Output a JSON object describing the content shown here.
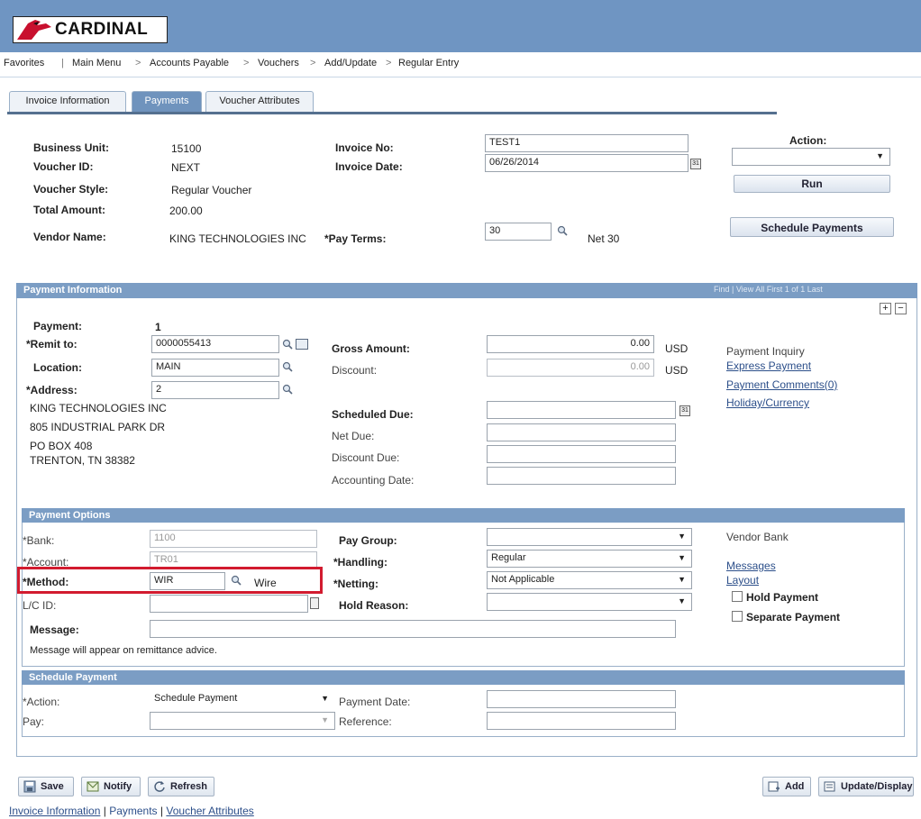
{
  "app": {
    "brand": "CARDINAL"
  },
  "breadcrumb": [
    "Favorites",
    "Main Menu",
    "Accounts Payable",
    "Vouchers",
    "Add/Update",
    "Regular Entry"
  ],
  "tabs": [
    {
      "label": "Invoice Information",
      "active": false
    },
    {
      "label": "Payments",
      "active": true
    },
    {
      "label": "Voucher Attributes",
      "active": false
    }
  ],
  "header": {
    "business_unit_label": "Business Unit:",
    "business_unit": "15100",
    "voucher_id_label": "Voucher ID:",
    "voucher_id": "NEXT",
    "voucher_style_label": "Voucher Style:",
    "voucher_style": "Regular Voucher",
    "total_amount_label": "Total Amount:",
    "total_amount": "200.00",
    "vendor_name_label": "Vendor Name:",
    "vendor_name": "KING TECHNOLOGIES INC",
    "invoice_no_label": "Invoice No:",
    "invoice_no": "TEST1",
    "invoice_date_label": "Invoice Date:",
    "invoice_date": "06/26/2014",
    "pay_terms_label": "*Pay Terms:",
    "pay_terms": "30",
    "pay_terms_desc": "Net 30",
    "action_label": "Action:",
    "action_value": "",
    "run_button": "Run",
    "schedule_payments_button": "Schedule Payments"
  },
  "payment_info": {
    "title": "Payment Information",
    "nav_text": "Find | View All  First  1 of 1  Last",
    "payment_label": "Payment:",
    "payment_value": "1",
    "remit_to_label": "*Remit to:",
    "remit_to": "0000055413",
    "location_label": "Location:",
    "location": "MAIN",
    "address_label": "*Address:",
    "address": "2",
    "address_lines": [
      "KING TECHNOLOGIES INC",
      "805 INDUSTRIAL PARK DR",
      "PO BOX 408",
      "TRENTON, TN  38382"
    ],
    "gross_amount_label": "Gross Amount:",
    "gross_amount": "0.00",
    "gross_currency": "USD",
    "discount_label": "Discount:",
    "discount": "0.00",
    "discount_currency": "USD",
    "scheduled_due_label": "Scheduled Due:",
    "scheduled_due": "",
    "net_due_label": "Net Due:",
    "net_due": "",
    "discount_due_label": "Discount Due:",
    "discount_due": "",
    "accounting_date_label": "Accounting Date:",
    "accounting_date": "",
    "payment_inquiry": "Payment Inquiry",
    "express_payment_link": "Express Payment",
    "payment_comments_link": "Payment Comments(0)",
    "holiday_currency_link": "Holiday/Currency"
  },
  "payment_options": {
    "title": "Payment Options",
    "bank_label": "*Bank:",
    "bank": "1100",
    "account_label": "*Account:",
    "account": "TR01",
    "method_label": "*Method:",
    "method": "WIR",
    "method_desc": "Wire",
    "lc_id_label": "L/C ID:",
    "lc_id": "",
    "message_label": "Message:",
    "message": "",
    "message_note": "Message will appear on remittance advice.",
    "pay_group_label": "Pay Group:",
    "pay_group": "",
    "handling_label": "*Handling:",
    "handling": "Regular",
    "netting_label": "*Netting:",
    "netting": "Not Applicable",
    "hold_reason_label": "Hold Reason:",
    "hold_reason": "",
    "vendor_bank": "Vendor Bank",
    "messages_link": "Messages",
    "layout_link": "Layout",
    "hold_payment_label": "Hold Payment",
    "separate_payment_label": "Separate Payment"
  },
  "schedule_payment": {
    "title": "Schedule Payment",
    "action_label": "*Action:",
    "action": "Schedule Payment",
    "pay_label": "Pay:",
    "pay": "",
    "payment_date_label": "Payment Date:",
    "payment_date": "",
    "reference_label": "Reference:",
    "reference": ""
  },
  "toolbar": {
    "save": "Save",
    "notify": "Notify",
    "refresh": "Refresh",
    "add": "Add",
    "update_display": "Update/Display"
  },
  "footer_links": {
    "invoice_information": "Invoice Information",
    "payments": "Payments",
    "voucher_attributes": "Voucher Attributes",
    "sep": "|"
  },
  "colors": {
    "header_bg": "#6f95c2",
    "section_head": "#7b9dc4",
    "highlight": "#d21b2f",
    "link": "#2c4f8a"
  },
  "icons": [
    "cardinal-bird-icon",
    "magnifier-icon",
    "calendar-icon",
    "detail-icon",
    "plus-icon",
    "minus-icon",
    "save-icon",
    "notify-icon",
    "refresh-icon",
    "add-icon",
    "update-display-icon"
  ]
}
